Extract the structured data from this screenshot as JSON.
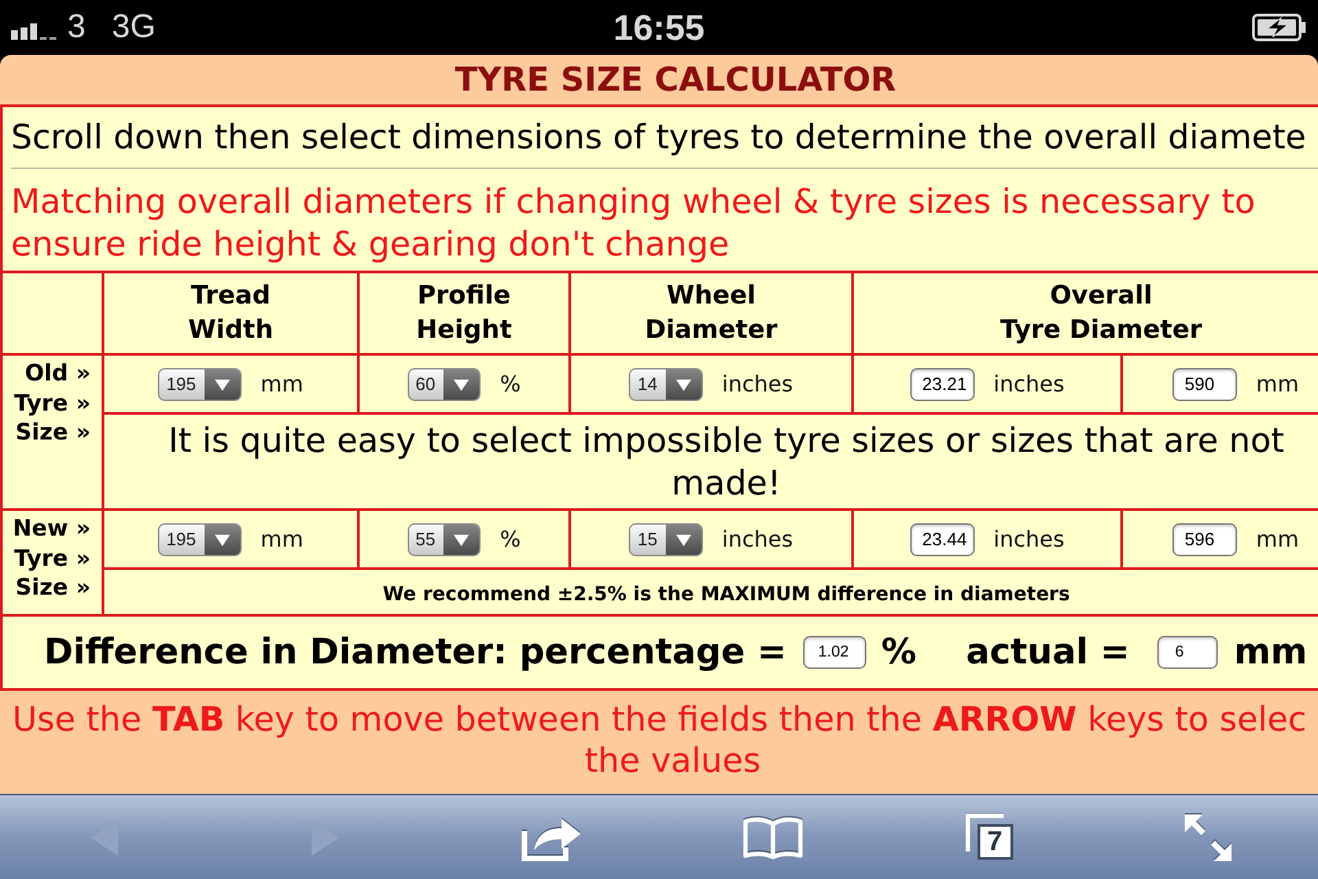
{
  "status_bar": {
    "carrier": "3",
    "network": "3G",
    "time": "16:55",
    "charging": true
  },
  "title": "TYRE SIZE CALCULATOR",
  "intro": "Scroll down then select dimensions of tyres to determine the overall diamete",
  "warning": "Matching overall diameters if changing wheel & tyre sizes is necessary to ensure ride height & gearing don't change",
  "table": {
    "columns": [
      {
        "lines": [
          "Tread",
          "Width"
        ]
      },
      {
        "lines": [
          "Profile",
          "Height"
        ]
      },
      {
        "lines": [
          "Wheel",
          "Diameter"
        ]
      },
      {
        "lines": [
          "Overall",
          "Tyre Diameter"
        ],
        "colspan": 2
      }
    ],
    "rows": [
      {
        "label": [
          "Old »",
          "Tyre »",
          "Size »"
        ],
        "cells": [
          {
            "kind": "select",
            "value": "195",
            "unit": "mm"
          },
          {
            "kind": "select",
            "value": "60",
            "unit": "%"
          },
          {
            "kind": "select",
            "value": "14",
            "unit": "inches"
          },
          {
            "kind": "field",
            "value": "23.21",
            "unit": "inches"
          },
          {
            "kind": "field",
            "value": "590",
            "unit": "mm"
          }
        ],
        "note": {
          "kind": "large",
          "text": "It is quite easy to select impossible tyre sizes or sizes that are not made!"
        }
      },
      {
        "label": [
          "New »",
          "Tyre »",
          "Size »"
        ],
        "cells": [
          {
            "kind": "select",
            "value": "195",
            "unit": "mm"
          },
          {
            "kind": "select",
            "value": "55",
            "unit": "%"
          },
          {
            "kind": "select",
            "value": "15",
            "unit": "inches"
          },
          {
            "kind": "field",
            "value": "23.44",
            "unit": "inches"
          },
          {
            "kind": "field",
            "value": "596",
            "unit": "mm"
          }
        ],
        "note": {
          "kind": "bold",
          "text": "We recommend ±2.5% is the MAXIMUM difference in diameters"
        }
      }
    ]
  },
  "difference": {
    "label": "Difference in Diameter: percentage =",
    "percentage": "1.02",
    "percent_unit": "%",
    "actual_label": "actual =",
    "actual": "6",
    "actual_unit": "mm"
  },
  "footer": {
    "lines": [
      "Use the **TAB** key to move between the fields then the **ARROW** keys to selec",
      "the values"
    ]
  },
  "toolbar": {
    "items": [
      {
        "kind": "back",
        "disabled": true
      },
      {
        "kind": "forward",
        "disabled": true
      },
      {
        "kind": "share",
        "disabled": false
      },
      {
        "kind": "bookmarks",
        "disabled": false
      },
      {
        "kind": "tabs",
        "count": "7",
        "disabled": false
      },
      {
        "kind": "fullscreen",
        "disabled": false
      }
    ]
  }
}
